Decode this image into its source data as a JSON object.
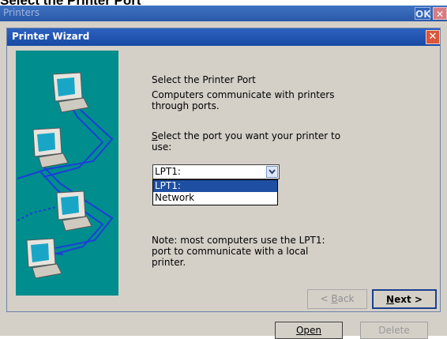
{
  "caption": "Select the Printer Port",
  "background_window": {
    "title": "Printers",
    "ok_label": "OK",
    "close_label": "✕",
    "buttons": {
      "open": "Open",
      "delete": "Delete"
    }
  },
  "dialog": {
    "title": "Printer Wizard",
    "close_label": "✕",
    "heading": "Select the Printer Port",
    "description": "Computers communicate with printers through ports.",
    "prompt_accesskey": "S",
    "prompt_rest": "elect the port you want your printer to use:",
    "port_select": {
      "value": "LPT1:",
      "options": [
        "LPT1:",
        "Network"
      ],
      "highlighted": "LPT1:"
    },
    "note": "Note: most computers use the LPT1: port to communicate with a local printer.",
    "back_button": {
      "prefix": "< ",
      "accesskey": "B",
      "rest": "ack"
    },
    "next_button": {
      "accesskey": "N",
      "rest": "ext >"
    }
  },
  "illustration": {
    "icons": [
      "computer-icon",
      "computer-icon",
      "computer-icon",
      "computer-icon"
    ],
    "colors": {
      "panel": "#008d8d",
      "cable": "#1d3fd8",
      "screen": "#19a6c6"
    }
  }
}
